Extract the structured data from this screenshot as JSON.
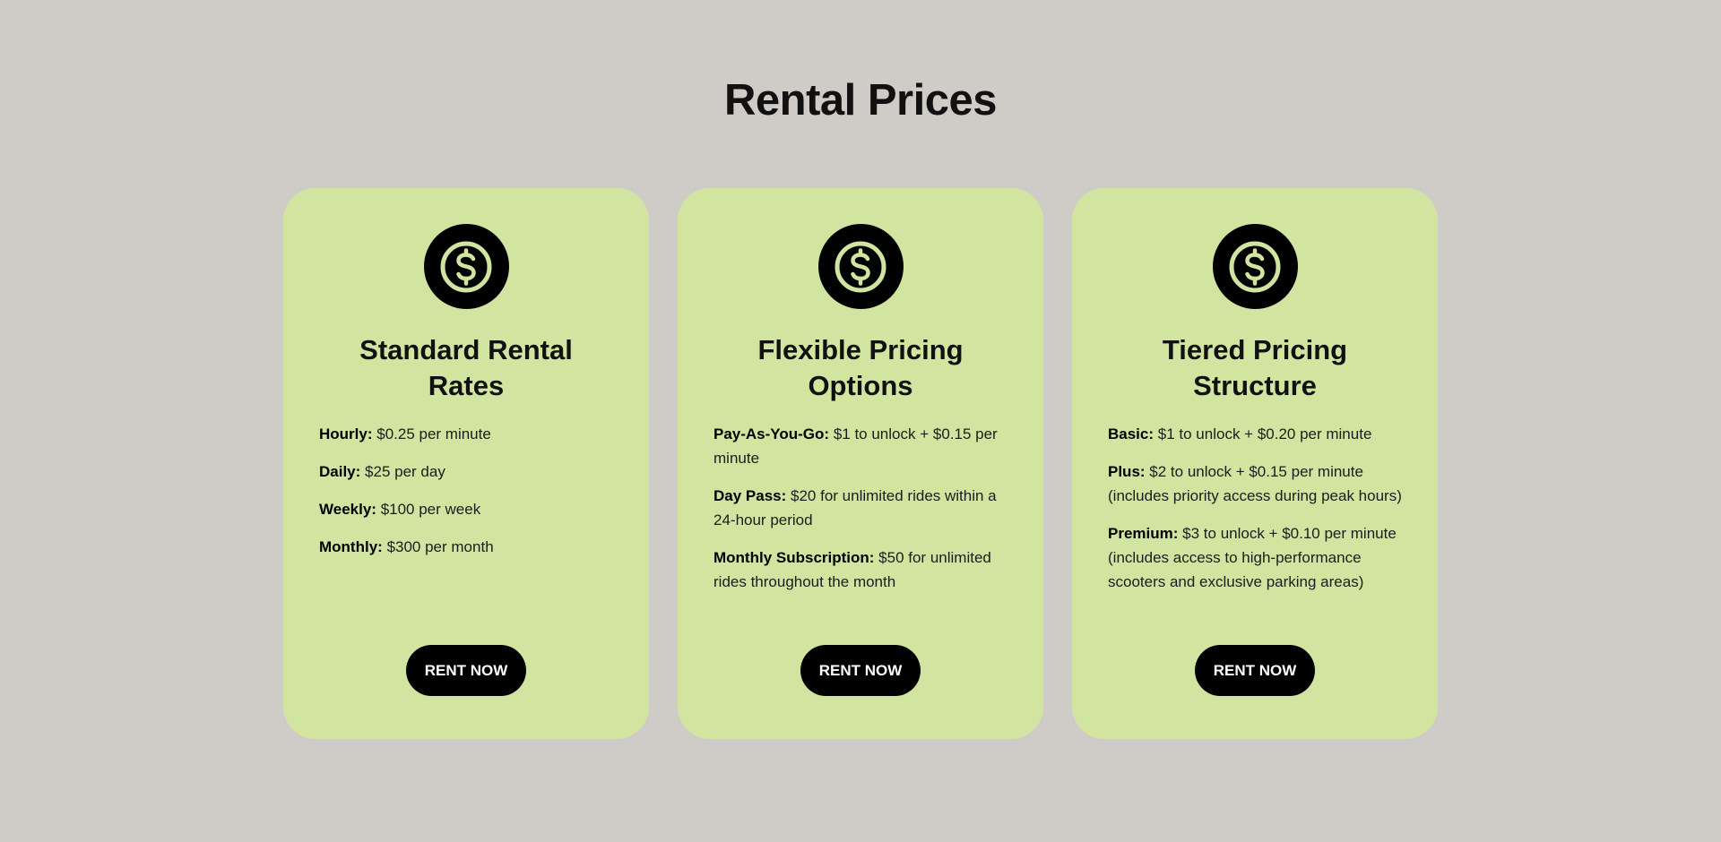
{
  "page": {
    "title": "Rental Prices"
  },
  "colors": {
    "background": "#cfccc8",
    "card": "#d1e5a1",
    "accent": "#000000",
    "icon_stroke": "#d1e5a1"
  },
  "cards": [
    {
      "icon": "dollar-circle-icon",
      "title": "Standard Rental Rates",
      "items": [
        {
          "label": "Hourly:",
          "text": "$0.25 per minute"
        },
        {
          "label": "Daily:",
          "text": "$25 per day"
        },
        {
          "label": "Weekly:",
          "text": "$100 per week"
        },
        {
          "label": "Monthly:",
          "text": "$300 per month"
        }
      ],
      "button": "RENT NOW"
    },
    {
      "icon": "dollar-circle-icon",
      "title": "Flexible Pricing Options",
      "items": [
        {
          "label": "Pay-As-You-Go:",
          "text": "$1 to unlock + $0.15 per minute"
        },
        {
          "label": "Day Pass:",
          "text": "$20 for unlimited rides within a 24-hour period"
        },
        {
          "label": "Monthly Subscription:",
          "text": "$50 for unlimited rides throughout the month"
        }
      ],
      "button": "RENT NOW"
    },
    {
      "icon": "dollar-circle-icon",
      "title": "Tiered Pricing Structure",
      "items": [
        {
          "label": "Basic:",
          "text": "$1 to unlock + $0.20 per minute"
        },
        {
          "label": "Plus:",
          "text": "$2 to unlock + $0.15 per minute (includes priority access during peak hours)"
        },
        {
          "label": "Premium:",
          "text": "$3 to unlock + $0.10 per minute (includes access to high-performance scooters and exclusive parking areas)"
        }
      ],
      "button": "RENT NOW"
    }
  ]
}
